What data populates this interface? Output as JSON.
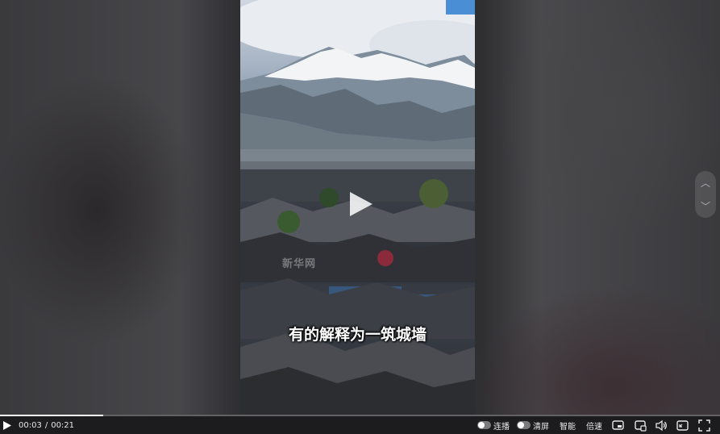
{
  "video": {
    "subtitle": "有的解释为一筑城墙",
    "watermark": "新华网",
    "progress": 0.143
  },
  "controls": {
    "current_time": "00:03",
    "separator": "/",
    "duration": "00:21",
    "autoplay_label": "连播",
    "clear_screen_label": "清屏",
    "smart_label": "智能",
    "speed_label": "倍速"
  },
  "icons": {
    "play": "play-icon",
    "nav_up": "chevron-up-icon",
    "nav_down": "chevron-down-icon",
    "pip": "picture-in-picture-icon",
    "window": "mini-window-icon",
    "volume": "volume-icon",
    "fullscreen_page": "web-fullscreen-icon",
    "fullscreen": "fullscreen-icon"
  }
}
